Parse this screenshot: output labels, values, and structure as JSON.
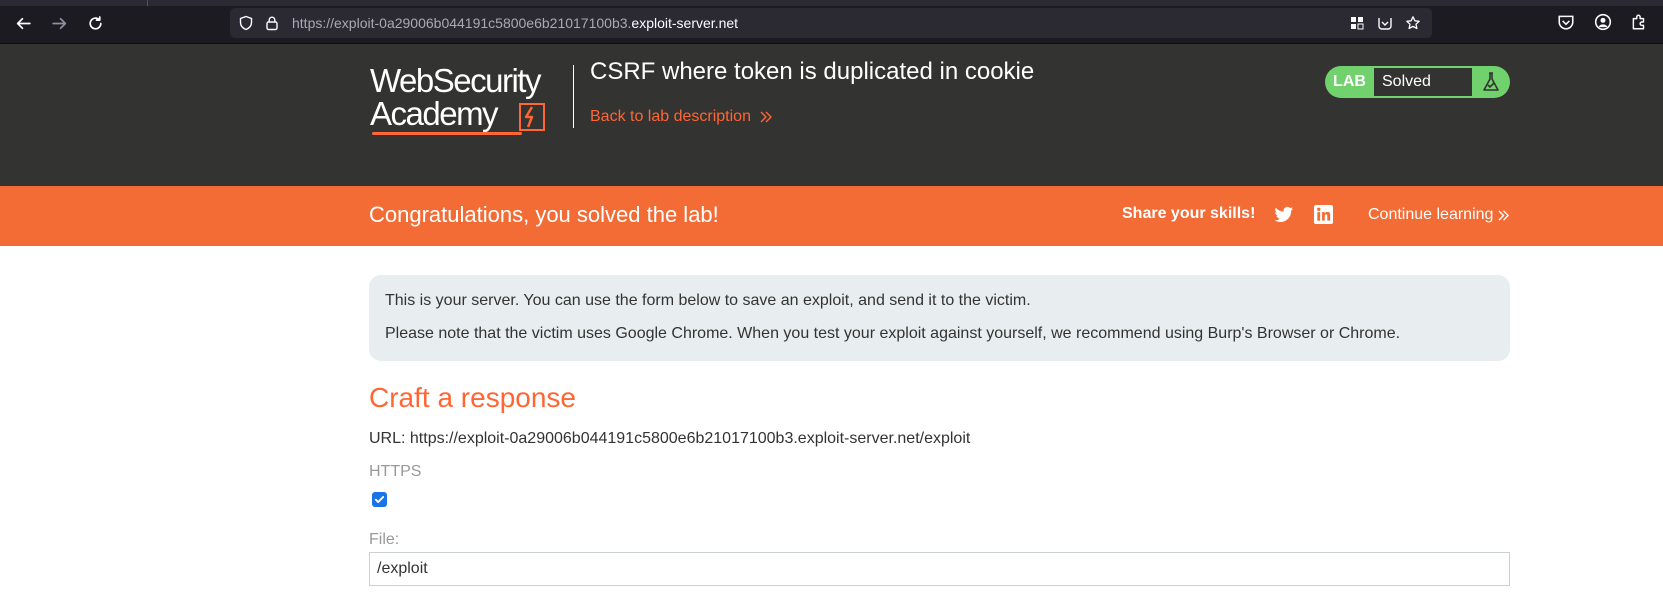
{
  "browser": {
    "url_prefix": "https://exploit-0a29006b044191c5800e6b21017100b3.",
    "url_host": "exploit-server.net"
  },
  "header": {
    "logo_line1": "WebSecurity",
    "logo_line2": "Academy",
    "lab_title": "CSRF where token is duplicated in cookie",
    "back_link": "Back to lab description",
    "lab_tag": "LAB",
    "lab_status": "Solved"
  },
  "banner": {
    "message": "Congratulations, you solved the lab!",
    "share": "Share your skills!",
    "continue": "Continue learning"
  },
  "notice": {
    "line1": "This is your server. You can use the form below to save an exploit, and send it to the victim.",
    "line2": "Please note that the victim uses Google Chrome. When you test your exploit against yourself, we recommend using Burp's Browser or Chrome."
  },
  "form": {
    "title": "Craft a response",
    "url_text": "URL: https://exploit-0a29006b044191c5800e6b21017100b3.exploit-server.net/exploit",
    "https_label": "HTTPS",
    "https_checked": true,
    "file_label": "File:",
    "file_value": "/exploit"
  },
  "colors": {
    "accent": "#ff6633",
    "header_bg": "#333332",
    "banner_bg": "#f36b35",
    "lab_green": "#70d16d",
    "notice_bg": "#e8eef0"
  }
}
